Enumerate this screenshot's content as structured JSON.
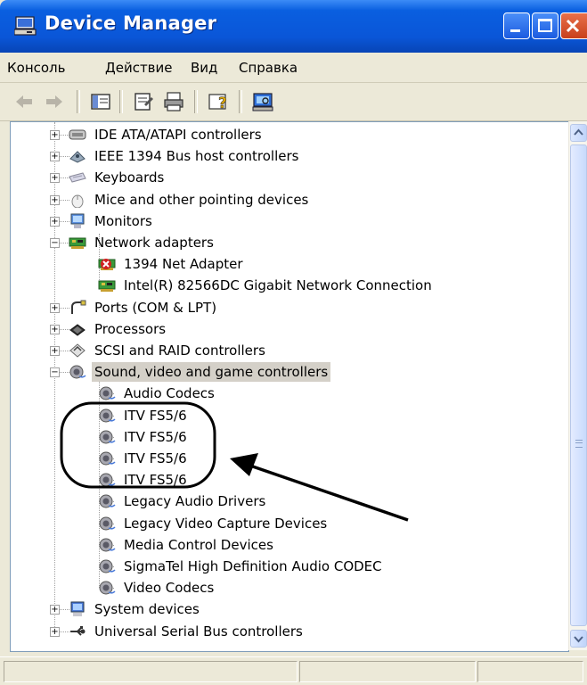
{
  "window": {
    "title": "Device Manager"
  },
  "menu": {
    "items": [
      "Консоль",
      "Действие",
      "Вид",
      "Справка"
    ]
  },
  "toolbar": {
    "buttons": [
      "back-icon",
      "forward-icon",
      "show-hide-tree-icon",
      "properties-icon",
      "print-icon",
      "help-icon",
      "scan-hardware-icon"
    ]
  },
  "tree": {
    "rows": [
      {
        "label": "IDE ATA/ATAPI controllers",
        "icon": "ide-controller-icon",
        "expander": "+"
      },
      {
        "label": "IEEE 1394 Bus host controllers",
        "icon": "ieee1394-icon",
        "expander": "+"
      },
      {
        "label": "Keyboards",
        "icon": "keyboard-icon",
        "expander": "+"
      },
      {
        "label": "Mice and other pointing devices",
        "icon": "mouse-icon",
        "expander": "+"
      },
      {
        "label": "Monitors",
        "icon": "monitor-icon",
        "expander": "+"
      },
      {
        "label": "Network adapters",
        "icon": "network-adapter-icon",
        "expander": "−"
      },
      {
        "label": "1394 Net Adapter",
        "icon": "network-card-disabled-icon"
      },
      {
        "label": "Intel(R) 82566DC Gigabit Network Connection",
        "icon": "network-card-icon"
      },
      {
        "label": "Ports (COM & LPT)",
        "icon": "port-icon",
        "expander": "+"
      },
      {
        "label": "Processors",
        "icon": "processor-icon",
        "expander": "+"
      },
      {
        "label": "SCSI and RAID controllers",
        "icon": "scsi-icon",
        "expander": "+"
      },
      {
        "label": "Sound, video and game controllers",
        "icon": "sound-icon",
        "expander": "−",
        "selected": true
      },
      {
        "label": "Audio Codecs",
        "icon": "sound-device-icon"
      },
      {
        "label": "ITV FS5/6",
        "icon": "sound-device-icon"
      },
      {
        "label": "ITV FS5/6",
        "icon": "sound-device-icon"
      },
      {
        "label": "ITV FS5/6",
        "icon": "sound-device-icon"
      },
      {
        "label": "ITV FS5/6",
        "icon": "sound-device-icon"
      },
      {
        "label": "Legacy Audio Drivers",
        "icon": "sound-device-icon"
      },
      {
        "label": "Legacy Video Capture Devices",
        "icon": "sound-device-icon"
      },
      {
        "label": "Media Control Devices",
        "icon": "sound-device-icon"
      },
      {
        "label": "SigmaTel High Definition Audio CODEC",
        "icon": "sound-device-icon"
      },
      {
        "label": "Video Codecs",
        "icon": "sound-device-icon"
      },
      {
        "label": "System devices",
        "icon": "system-device-icon",
        "expander": "+"
      },
      {
        "label": "Universal Serial Bus controllers",
        "icon": "usb-icon",
        "expander": "+"
      }
    ]
  },
  "annotation": {
    "color": "#000000"
  }
}
